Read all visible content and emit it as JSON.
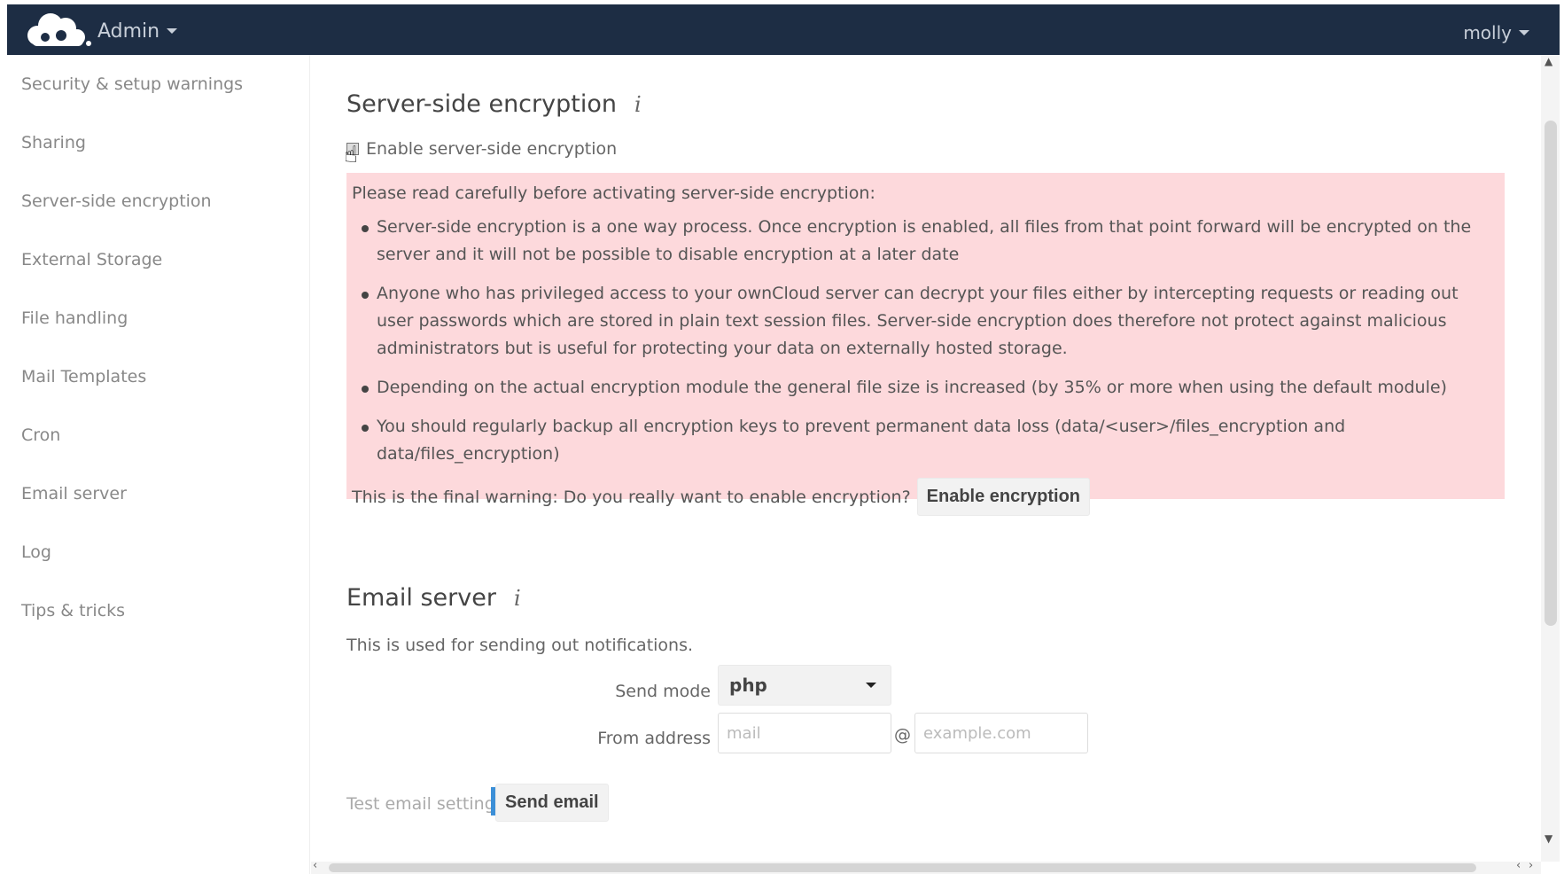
{
  "header": {
    "app_name": "Admin",
    "user_name": "molly"
  },
  "sidebar": {
    "items": [
      {
        "label": "Security & setup warnings"
      },
      {
        "label": "Sharing"
      },
      {
        "label": "Server-side encryption"
      },
      {
        "label": "External Storage"
      },
      {
        "label": "File handling"
      },
      {
        "label": "Mail Templates"
      },
      {
        "label": "Cron"
      },
      {
        "label": "Email server"
      },
      {
        "label": "Log"
      },
      {
        "label": "Tips & tricks"
      }
    ]
  },
  "encryption": {
    "title": "Server-side encryption",
    "info_glyph": "i",
    "checkbox_label": "Enable server-side encryption",
    "checkbox_checked": true,
    "warning_intro": "Please read carefully before activating server-side encryption:",
    "warnings": [
      "Server-side encryption is a one way process. Once encryption is enabled, all files from that point forward will be encrypted on the server and it will not be possible to disable encryption at a later date",
      "Anyone who has privileged access to your ownCloud server can decrypt your files either by intercepting requests or reading out user passwords which are stored in plain text session files. Server-side encryption does therefore not protect against malicious administrators but is useful for protecting your data on externally hosted storage.",
      "Depending on the actual encryption module the general file size is increased (by 35% or more when using the default module)",
      "You should regularly backup all encryption keys to prevent permanent data loss (data/<user>/files_encryption and data/files_encryption)"
    ],
    "final_warning": "This is the final warning: Do you really want to enable encryption?",
    "enable_button": "Enable encryption",
    "warning_bg": "#fdd9dc"
  },
  "email_server": {
    "title": "Email server",
    "info_glyph": "i",
    "description": "This is used for sending out notifications.",
    "send_mode_label": "Send mode",
    "send_mode_value": "php",
    "from_address_label": "From address",
    "from_placeholder": "mail",
    "at_sign": "@",
    "domain_placeholder": "example.com",
    "test_label": "Test email settings",
    "send_button": "Send email"
  },
  "colors": {
    "header_bg": "#1d2d44",
    "focus_accent": "#3c8fd7"
  }
}
